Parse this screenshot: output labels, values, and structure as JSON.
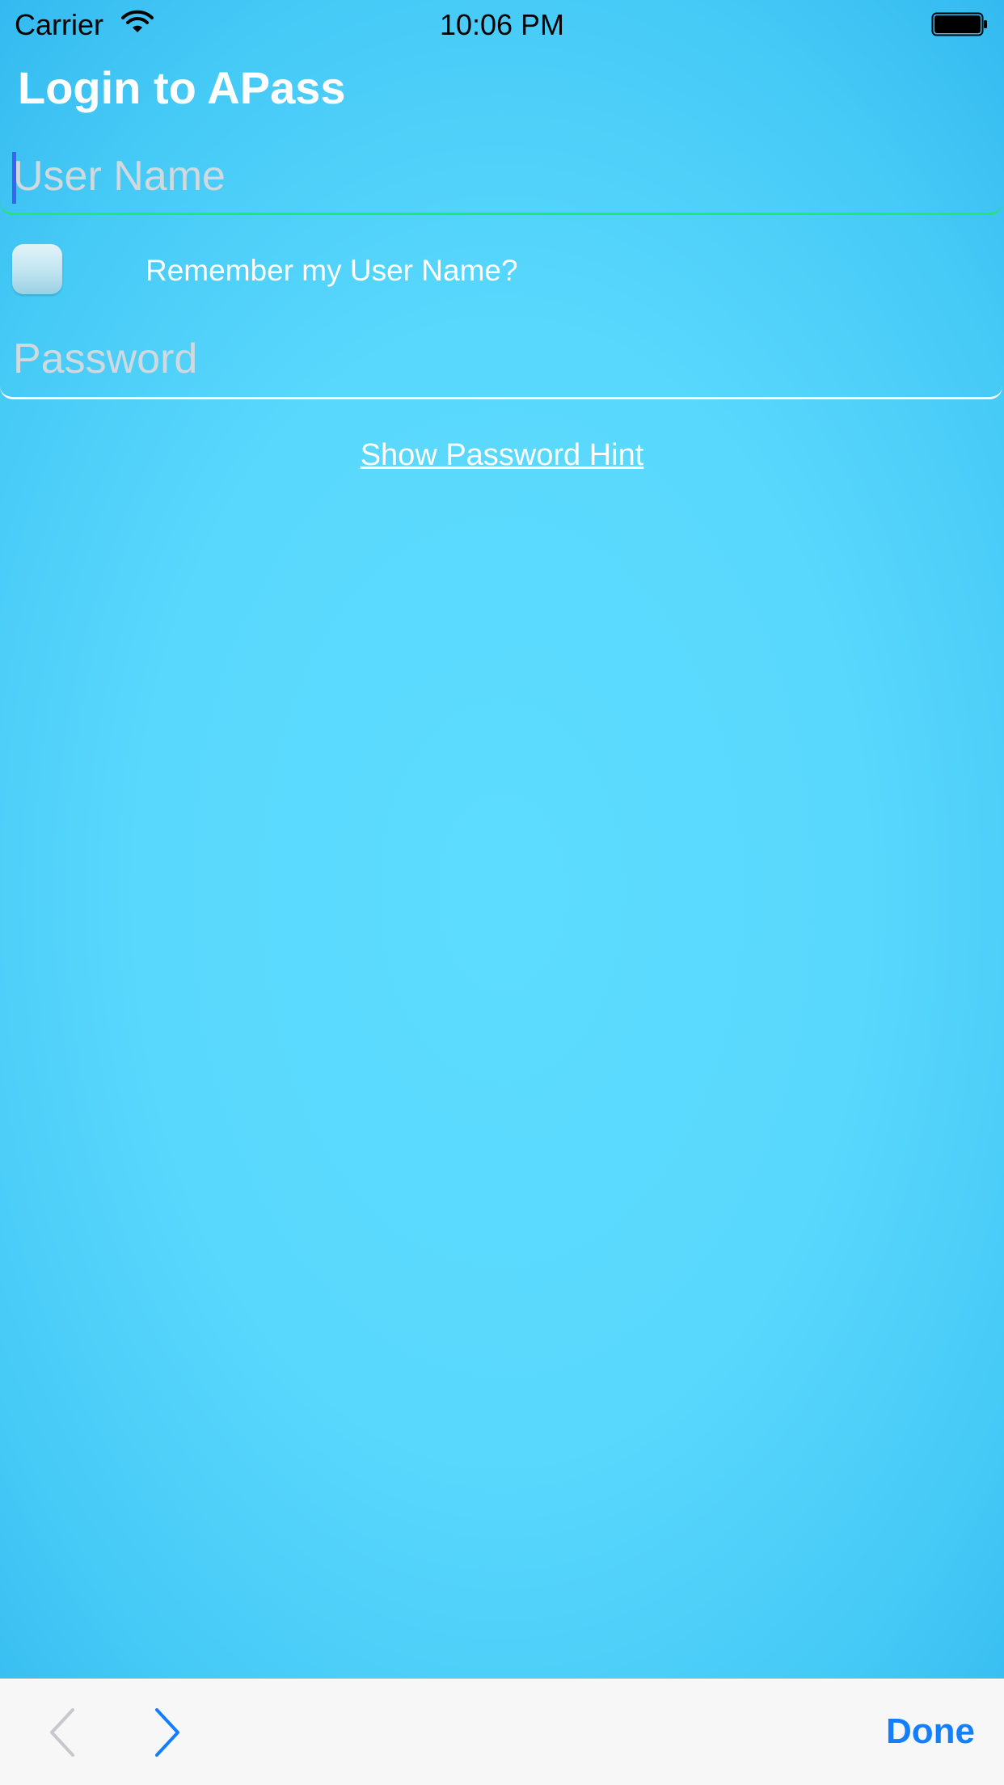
{
  "status_bar": {
    "carrier": "Carrier",
    "time": "10:06 PM",
    "wifi_icon": "wifi-icon",
    "battery_icon": "battery-icon"
  },
  "login": {
    "title": "Login to APass",
    "username": {
      "value": "",
      "placeholder": "User Name"
    },
    "remember": {
      "label": "Remember my User Name?",
      "checked": false
    },
    "password": {
      "value": "",
      "placeholder": "Password"
    },
    "hint_link": "Show Password Hint"
  },
  "keyboard_toolbar": {
    "prev_icon": "chevron-left-icon",
    "next_icon": "chevron-right-icon",
    "done_label": "Done"
  },
  "colors": {
    "background": "#5cdcfe",
    "username_underline_active": "#27e46a",
    "password_underline": "#ffffff",
    "cursor": "#3a63f2",
    "done_button": "#147efb",
    "toolbar_bg": "#f7f7f7"
  }
}
